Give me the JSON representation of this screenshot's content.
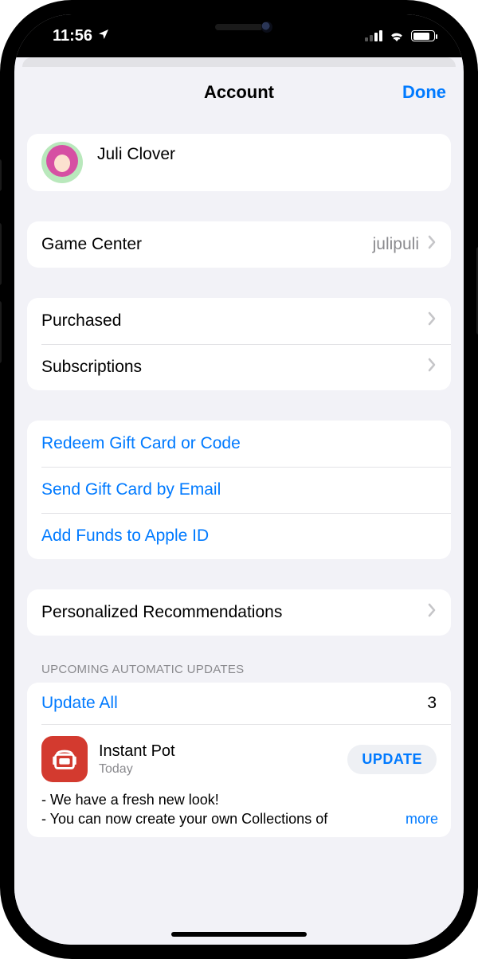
{
  "status": {
    "time": "11:56"
  },
  "nav": {
    "title": "Account",
    "done": "Done"
  },
  "profile": {
    "name": "Juli Clover"
  },
  "gamecenter": {
    "label": "Game Center",
    "value": "julipuli"
  },
  "purchases": {
    "purchased": "Purchased",
    "subscriptions": "Subscriptions"
  },
  "actions": {
    "redeem": "Redeem Gift Card or Code",
    "send": "Send Gift Card by Email",
    "funds": "Add Funds to Apple ID"
  },
  "recs": {
    "label": "Personalized Recommendations"
  },
  "updates": {
    "header": "UPCOMING AUTOMATIC UPDATES",
    "update_all": "Update All",
    "count": "3",
    "app": {
      "name": "Instant Pot",
      "date": "Today",
      "button": "UPDATE",
      "notes_line1": "- We have a fresh new look!",
      "notes_line2": "- You can now create your own Collections of",
      "more": "more"
    }
  }
}
